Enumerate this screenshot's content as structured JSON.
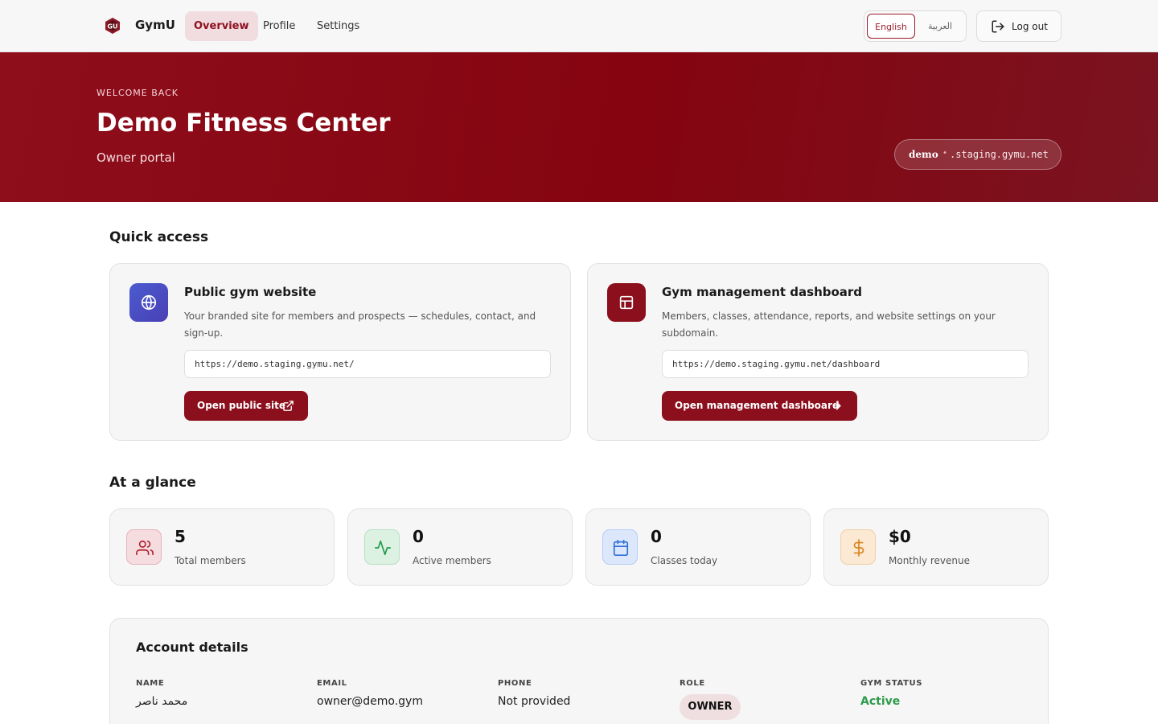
{
  "app": {
    "brand": "GymU"
  },
  "nav": {
    "tabs": [
      {
        "label": "Overview",
        "active": true
      },
      {
        "label": "Profile",
        "active": false
      },
      {
        "label": "Settings",
        "active": false
      }
    ],
    "languages": {
      "english": "English",
      "arabic": "العربية",
      "selected": "English"
    },
    "logout_label": "Log out"
  },
  "hero": {
    "eyebrow": "WELCOME BACK",
    "title": "Demo Fitness Center",
    "subtitle": "Owner portal",
    "domain_sub": "demo",
    "domain_sep": "•",
    "domain_rest": ".staging.gymu.net"
  },
  "quick_access": {
    "title": "Quick access",
    "cards": [
      {
        "title": "Public gym website",
        "description": "Your branded site for members and prospects — schedules, contact, and sign-up.",
        "url": "https://demo.staging.gymu.net/",
        "button": "Open public site",
        "icon": "globe-icon",
        "accent": "#4a4fc4"
      },
      {
        "title": "Gym management dashboard",
        "description": "Members, classes, attendance, reports, and website settings on your subdomain.",
        "url": "https://demo.staging.gymu.net/dashboard",
        "button": "Open management dashboard",
        "icon": "layout-icon",
        "accent": "#8c0f1d"
      }
    ]
  },
  "glance": {
    "title": "At a glance",
    "stats": [
      {
        "value": "5",
        "label": "Total members",
        "icon": "users-icon",
        "color": "#b0202f"
      },
      {
        "value": "0",
        "label": "Active members",
        "icon": "activity-icon",
        "color": "#1f9a4a"
      },
      {
        "value": "0",
        "label": "Classes today",
        "icon": "calendar-icon",
        "color": "#2f6fd6"
      },
      {
        "value": "$0",
        "label": "Monthly revenue",
        "icon": "dollar-icon",
        "color": "#d9831b"
      }
    ]
  },
  "account": {
    "title": "Account details",
    "name_label": "NAME",
    "name": "محمد ناصر",
    "email_label": "EMAIL",
    "email": "owner@demo.gym",
    "phone_label": "PHONE",
    "phone": "Not provided",
    "role_label": "ROLE",
    "role": "OWNER",
    "status_label": "GYM STATUS",
    "status": "Active"
  },
  "colors": {
    "brand": "#8c0f1d",
    "hero": "#850410",
    "success": "#2e9b4b"
  }
}
